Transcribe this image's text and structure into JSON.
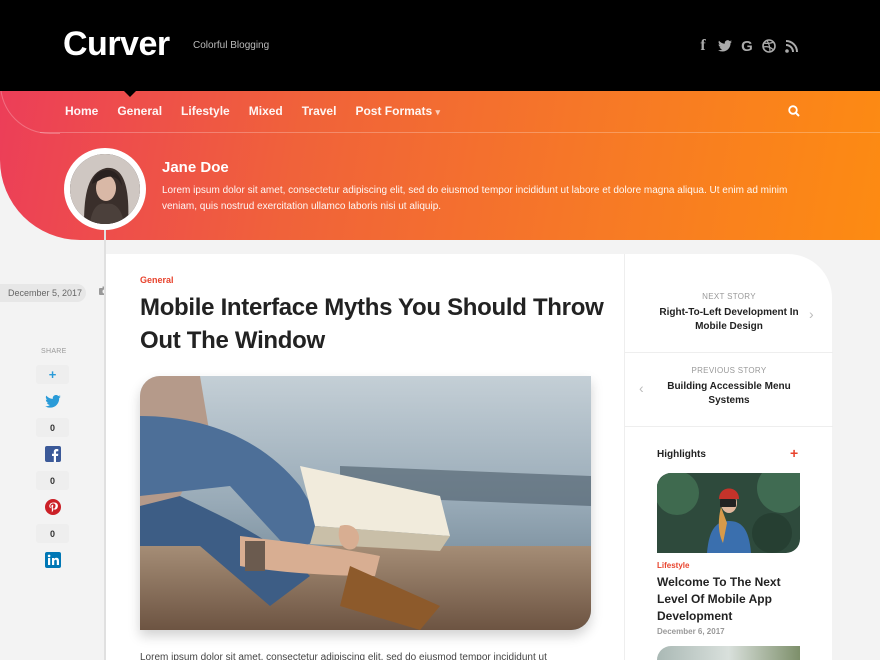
{
  "site": {
    "logo": "Curver",
    "tagline": "Colorful Blogging"
  },
  "social": [
    {
      "icon": "facebook-icon",
      "glyph": "f"
    },
    {
      "icon": "twitter-icon",
      "glyph": "🐦"
    },
    {
      "icon": "google-icon",
      "glyph": "G"
    },
    {
      "icon": "dribbble-icon",
      "glyph": "⊕"
    },
    {
      "icon": "rss-icon",
      "glyph": "⦿"
    }
  ],
  "nav": {
    "items": [
      "Home",
      "General",
      "Lifestyle",
      "Mixed",
      "Travel",
      "Post Formats"
    ],
    "active": "General",
    "dropdown_glyph": "⌄"
  },
  "author": {
    "name": "Jane Doe",
    "bio": "Lorem ipsum dolor sit amet, consectetur adipiscing elit, sed do eiusmod tempor incididunt ut labore et dolore magna aliqua. Ut enim ad minim veniam, quis nostrud exercitation ullamco laboris nisi ut aliquip."
  },
  "post": {
    "date": "December 5, 2017",
    "category": "General",
    "title": "Mobile Interface Myths You Should Throw Out The Window",
    "excerpt": "Lorem ipsum dolor sit amet, consectetur adipiscing elit, sed do eiusmod tempor incididunt ut"
  },
  "share": {
    "label": "SHARE",
    "plus": "+",
    "counts": {
      "twitter": "0",
      "facebook": "0",
      "pinterest": "0"
    }
  },
  "sidebar": {
    "next_label": "NEXT STORY",
    "next_title": "Right-To-Left Development In Mobile Design",
    "prev_label": "PREVIOUS STORY",
    "prev_title": "Building Accessible Menu Systems",
    "highlights_title": "Highlights",
    "highlight": {
      "category": "Lifestyle",
      "title": "Welcome To The Next Level Of Mobile App Development",
      "date": "December 6, 2017"
    }
  },
  "colors": {
    "accent": "#e8432d",
    "gradient_start": "#ec3c5a",
    "gradient_end": "#fd8b12",
    "twitter": "#2a9bd8",
    "facebook": "#3b5998",
    "pinterest": "#cb2027",
    "linkedin": "#0077b5"
  }
}
